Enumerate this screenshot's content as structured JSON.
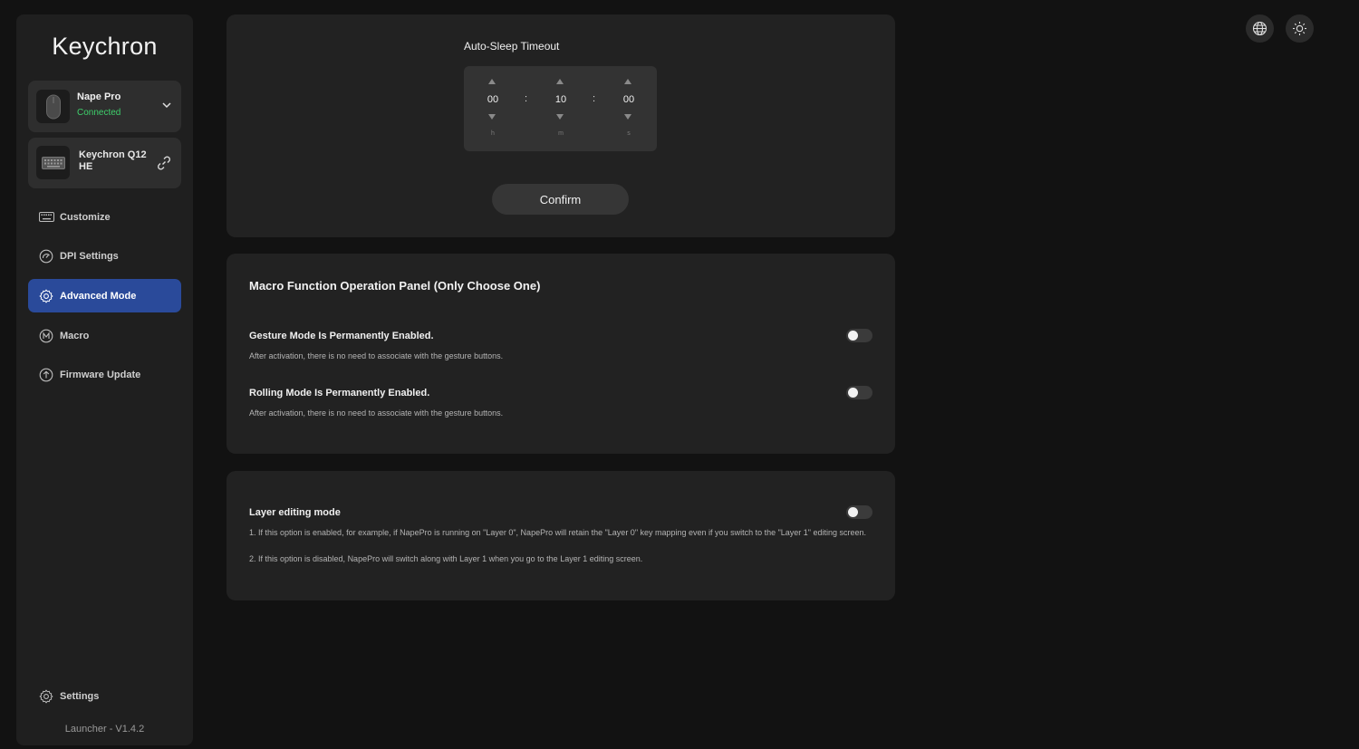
{
  "app": {
    "brand": "Keychron",
    "version": "Launcher - V1.4.2"
  },
  "devices": [
    {
      "name": "Nape Pro",
      "status": "Connected",
      "status_color": "#3ecf6b",
      "icon": "mouse-icon"
    },
    {
      "name": "Keychron Q12 HE",
      "icon": "keyboard-icon"
    }
  ],
  "nav": {
    "items": [
      {
        "label": "Customize",
        "icon": "keyboard-icon"
      },
      {
        "label": "DPI Settings",
        "icon": "dpi-gauge-icon"
      },
      {
        "label": "Advanced Mode",
        "icon": "gear-icon",
        "active": true
      },
      {
        "label": "Macro",
        "icon": "macro-m-icon"
      },
      {
        "label": "Firmware Update",
        "icon": "upload-arrow-icon"
      }
    ],
    "settings_label": "Settings"
  },
  "sleep": {
    "title": "Auto-Sleep Timeout",
    "hours": "00",
    "minutes": "10",
    "seconds": "00",
    "unit_h": "h",
    "unit_m": "m",
    "unit_s": "s",
    "separator": ":",
    "confirm_label": "Confirm"
  },
  "macro_panel": {
    "title": "Macro Function Operation Panel (Only Choose One)",
    "gesture": {
      "label": "Gesture Mode Is Permanently Enabled.",
      "desc": "After activation, there is no need to associate with the gesture buttons.",
      "enabled": false
    },
    "rolling": {
      "label": "Rolling Mode Is Permanently Enabled.",
      "desc": "After activation, there is no need to associate with the gesture buttons.",
      "enabled": false
    }
  },
  "layer_panel": {
    "label": "Layer editing mode",
    "desc1": "1. If this option is enabled, for example, if NapePro is running on \"Layer 0\", NapePro will retain the \"Layer 0\" key mapping even if you switch to the \"Layer 1\" editing screen.",
    "desc2": "2. If this option is disabled, NapePro will switch along with Layer 1 when you go to the Layer 1 editing screen.",
    "enabled": false
  },
  "colors": {
    "accent": "#2a4a9a",
    "background": "#121212",
    "panel": "#222222"
  },
  "top_icons": [
    "globe-icon",
    "brightness-icon"
  ]
}
